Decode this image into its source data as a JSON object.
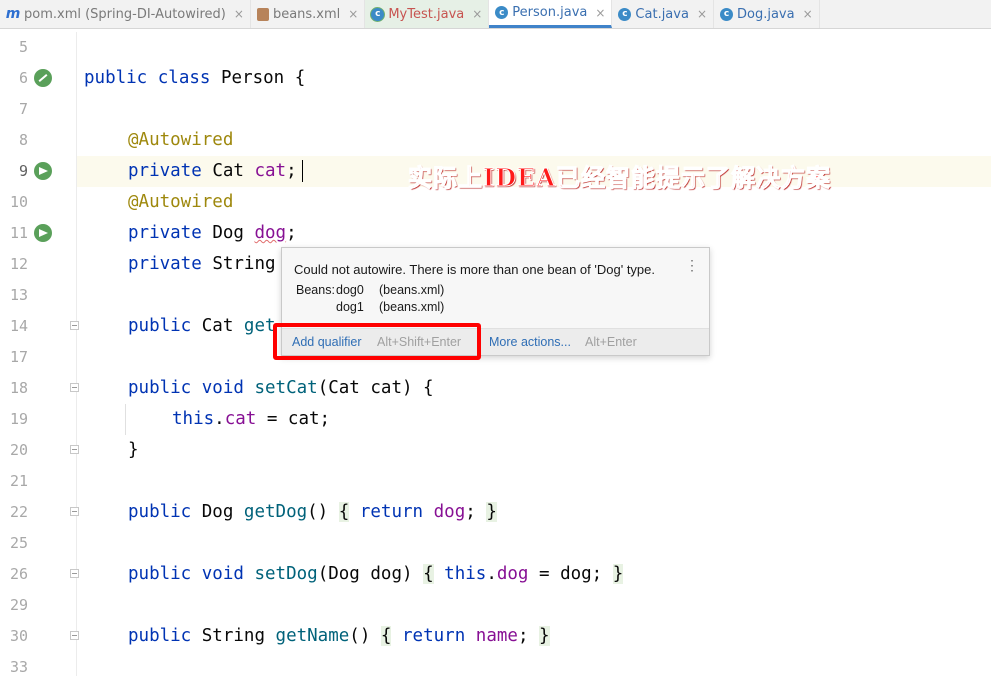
{
  "tabs": [
    {
      "icon": "maven-icon",
      "label": "pom.xml (Spring-DI-Autowired)",
      "style": "mod"
    },
    {
      "icon": "xml-file-icon",
      "label": "beans.xml",
      "style": "mod"
    },
    {
      "icon": "class-icon",
      "label": "MyTest.java",
      "style": "green"
    },
    {
      "icon": "class-icon",
      "label": "Person.java",
      "style": "active"
    },
    {
      "icon": "class-icon",
      "label": "Cat.java",
      "style": "blue"
    },
    {
      "icon": "class-icon",
      "label": "Dog.java",
      "style": "red"
    }
  ],
  "close_glyph": "×",
  "lines": [
    {
      "n": "5"
    },
    {
      "n": "6"
    },
    {
      "n": "7"
    },
    {
      "n": "8"
    },
    {
      "n": "9"
    },
    {
      "n": "10"
    },
    {
      "n": "11"
    },
    {
      "n": "12"
    },
    {
      "n": "13"
    },
    {
      "n": "14"
    },
    {
      "n": "17"
    },
    {
      "n": "18"
    },
    {
      "n": "19"
    },
    {
      "n": "20"
    },
    {
      "n": "21"
    },
    {
      "n": "22"
    },
    {
      "n": "25"
    },
    {
      "n": "26"
    },
    {
      "n": "29"
    },
    {
      "n": "30"
    },
    {
      "n": "33"
    }
  ],
  "code": {
    "l6": [
      "public",
      "class",
      "Person {"
    ],
    "l8": [
      "@Autowired"
    ],
    "l9": [
      "private",
      "Cat",
      "cat",
      ";"
    ],
    "l10": [
      "@Autowired"
    ],
    "l11": [
      "private",
      "Dog",
      "dog",
      ";"
    ],
    "l12": [
      "private",
      "String"
    ],
    "l14": [
      "public",
      "Cat",
      "get"
    ],
    "l18": [
      "public",
      "void",
      "setCat",
      "(Cat cat) {"
    ],
    "l19": [
      "this",
      ".",
      "cat",
      " = cat;"
    ],
    "l20": [
      "}"
    ],
    "l22": [
      "public",
      "Dog",
      "getDog",
      "()",
      "{",
      "return",
      "dog",
      ";",
      "}"
    ],
    "l26": [
      "public",
      "void",
      "setDog",
      "(Dog dog)",
      "{",
      "this",
      ".",
      "dog",
      " = dog;",
      "}"
    ],
    "l30": [
      "public",
      "String",
      "getName",
      "()",
      "{",
      "return",
      "name",
      ";",
      "}"
    ]
  },
  "popup": {
    "message": "Could not autowire. There is more than one bean of 'Dog' type.",
    "beans_label": "Beans:",
    "beans": [
      {
        "name": "dog0",
        "source": "(beans.xml)"
      },
      {
        "name": "dog1",
        "source": "(beans.xml)"
      }
    ],
    "primary_action": "Add qualifier",
    "primary_shortcut": "Alt+Shift+Enter",
    "more_action": "More actions...",
    "more_shortcut": "Alt+Enter",
    "menu_glyph": "⋮"
  },
  "callout": "实际上IDEA已经智能提示了解决方案",
  "colors": {
    "keyword": "#0033b3",
    "annotation": "#9e880d",
    "field": "#871094",
    "method": "#00627a",
    "highlight": "#ff0000"
  }
}
